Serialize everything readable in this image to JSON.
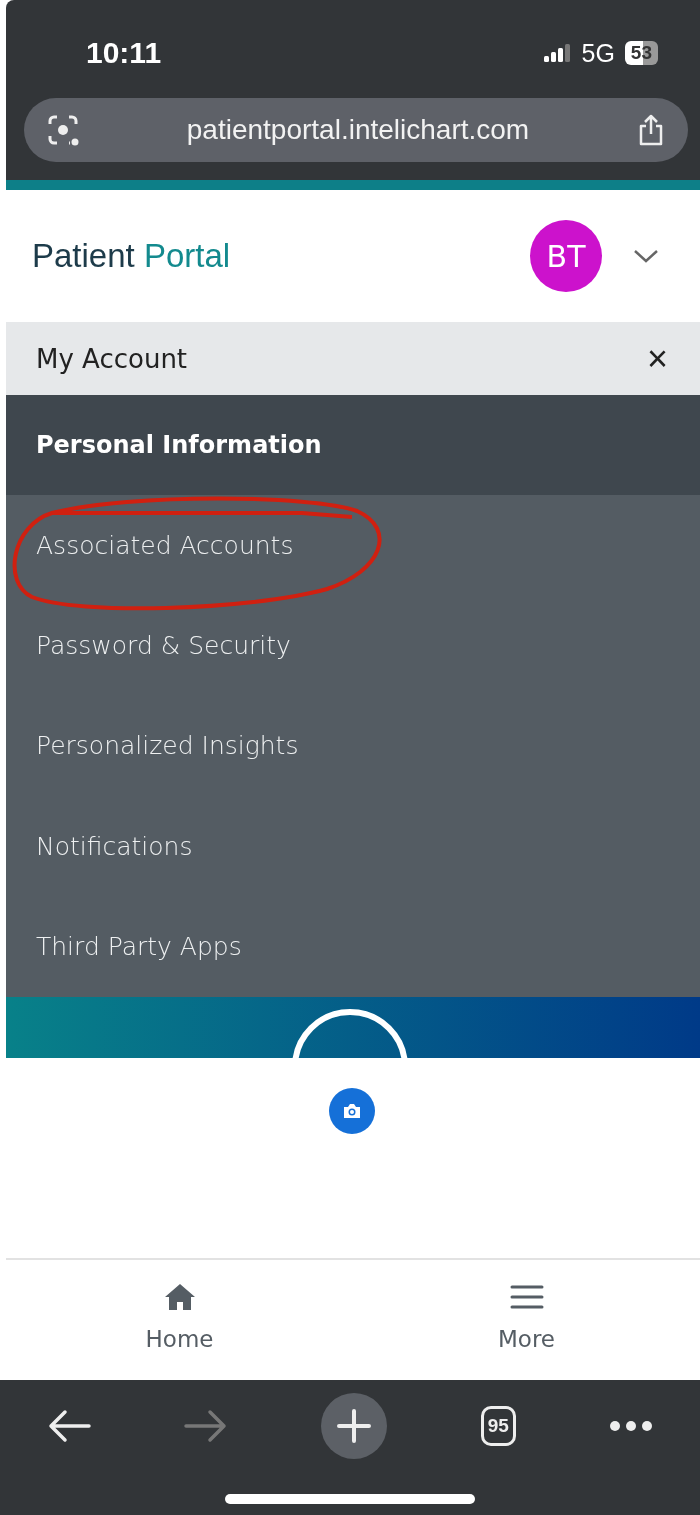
{
  "status_bar": {
    "time": "10:11",
    "network": "5G",
    "battery": "53"
  },
  "address_bar": {
    "url": "patientportal.intelichart.com"
  },
  "header": {
    "title_first": "Patient",
    "title_second": "Portal",
    "avatar_initials": "BT"
  },
  "menu": {
    "title": "My Account",
    "close": "×",
    "section": "Personal Information",
    "items": [
      {
        "label": "Associated Accounts",
        "circled": true
      },
      {
        "label": "Password & Security",
        "circled": false
      },
      {
        "label": "Personalized Insights",
        "circled": false
      },
      {
        "label": "Notifications",
        "circled": false
      },
      {
        "label": "Third Party Apps",
        "circled": false
      }
    ]
  },
  "bottom_nav": [
    {
      "label": "Home",
      "kind": "home"
    },
    {
      "label": "More",
      "kind": "more"
    }
  ],
  "browser_toolbar": {
    "tabs_count": "95"
  }
}
